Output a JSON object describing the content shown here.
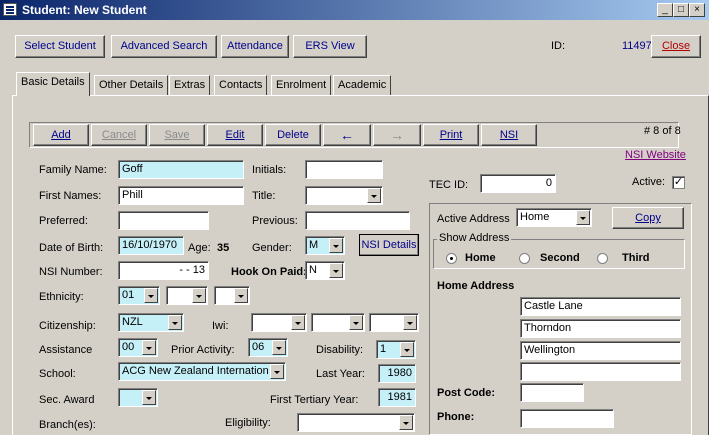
{
  "window": {
    "title": "Student: New Student"
  },
  "toolbar": {
    "select_student": "Select Student",
    "advanced_search": "Advanced Search",
    "attendance": "Attendance",
    "ers_view": "ERS View",
    "id_label": "ID:",
    "id_value": "11497",
    "close": "Close"
  },
  "tabs": [
    "Basic Details",
    "Other Details",
    "Extras",
    "Contacts",
    "Enrolment",
    "Academic"
  ],
  "nav": {
    "add": "Add",
    "cancel": "Cancel",
    "save": "Save",
    "edit": "Edit",
    "delete": "Delete",
    "print": "Print",
    "nsi": "NSI",
    "record_counter": "# 8 of 8",
    "nsi_website": "NSI Website"
  },
  "form": {
    "family_name_label": "Family Name:",
    "family_name": "Goff",
    "initials_label": "Initials:",
    "initials": "",
    "first_names_label": "First Names:",
    "first_names": "Phill",
    "title_label": "Title:",
    "title": "",
    "preferred_label": "Preferred:",
    "preferred": "",
    "previous_label": "Previous:",
    "previous": "",
    "dob_label": "Date of Birth:",
    "dob": "16/10/1970",
    "age_label": "Age:",
    "age": "35",
    "gender_label": "Gender:",
    "gender": "M",
    "nsi_details": "NSI Details",
    "nsi_number_label": "NSI Number:",
    "nsi_number": "- - 13",
    "hook_on_paid_label": "Hook On Paid:",
    "hook_on_paid": "N",
    "ethnicity_label": "Ethnicity:",
    "ethnicity_1": "01",
    "ethnicity_2": "",
    "ethnicity_3": "",
    "citizenship_label": "Citizenship:",
    "citizenship": "NZL",
    "iwi_label": "Iwi:",
    "iwi_1": "",
    "iwi_2": "",
    "iwi_3": "",
    "assistance_label": "Assistance",
    "assistance": "00",
    "prior_activity_label": "Prior Activity:",
    "prior_activity": "06",
    "disability_label": "Disability:",
    "disability": "1",
    "school_label": "School:",
    "school": "ACG New Zealand Internation",
    "last_year_label": "Last Year:",
    "last_year": "1980",
    "sec_award_label": "Sec. Award",
    "sec_award": "",
    "first_tertiary_label": "First Tertiary Year:",
    "first_tertiary": "1981",
    "branches_label": "Branch(es):",
    "eligibility_label": "Eligibility:",
    "eligibility": ""
  },
  "right": {
    "tec_id_label": "TEC ID:",
    "tec_id": "0",
    "active_label": "Active:",
    "active_check": "✓",
    "active_address_label": "Active Address",
    "active_address": "Home",
    "copy": "Copy",
    "show_address_label": "Show Address",
    "show_options": [
      "Home",
      "Second",
      "Third"
    ],
    "home_address_label": "Home Address",
    "address_lines": [
      "Castle Lane",
      "Thorndon",
      "Wellington",
      ""
    ],
    "post_code_label": "Post Code:",
    "post_code": "",
    "phone_label": "Phone:",
    "phone": ""
  }
}
